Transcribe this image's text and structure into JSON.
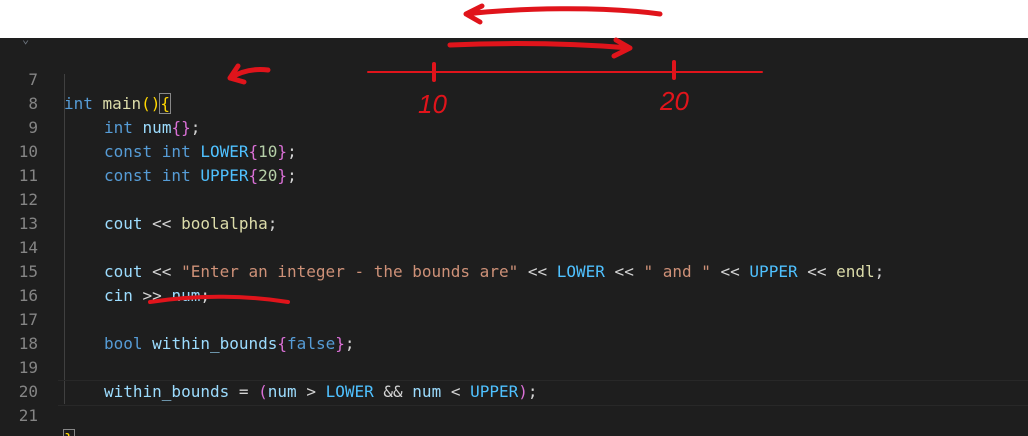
{
  "editor": {
    "lines": [
      {
        "n": "7"
      },
      {
        "n": "8"
      },
      {
        "n": "9"
      },
      {
        "n": "10"
      },
      {
        "n": "11"
      },
      {
        "n": "12"
      },
      {
        "n": "13"
      },
      {
        "n": "14"
      },
      {
        "n": "15"
      },
      {
        "n": "16"
      },
      {
        "n": "17"
      },
      {
        "n": "18"
      },
      {
        "n": "19"
      },
      {
        "n": "20"
      },
      {
        "n": "21"
      }
    ],
    "tokens": {
      "l7_kw": "int",
      "l7_fn": "main",
      "l7_paren": "()",
      "l7_brace": "{",
      "l8_kw": "int",
      "l8_var": "num",
      "l8_init": "{}",
      "l8_semi": ";",
      "l9_kw": "const int",
      "l9_var": "LOWER",
      "l9_open": "{",
      "l9_num": "10",
      "l9_close": "}",
      "l9_semi": ";",
      "l10_kw": "const int",
      "l10_var": "UPPER",
      "l10_open": "{",
      "l10_num": "20",
      "l10_close": "}",
      "l10_semi": ";",
      "l12_var": "cout",
      "l12_op": " << ",
      "l12_fn": "boolalpha",
      "l12_semi": ";",
      "l14_var": "cout",
      "l14_op1": " << ",
      "l14_str1": "\"Enter an integer - the bounds are\"",
      "l14_op2": " << ",
      "l14_var2": "LOWER",
      "l14_op3": " << ",
      "l14_str2": "\" and \"",
      "l14_op4": " << ",
      "l14_var3": "UPPER",
      "l14_op5": " << ",
      "l14_fn": "endl",
      "l14_semi": ";",
      "l15_var": "cin",
      "l15_op": " >> ",
      "l15_var2": "num",
      "l15_semi": ";",
      "l17_kw": "bool",
      "l17_var": "within_bounds",
      "l17_open": "{",
      "l17_val": "false",
      "l17_close": "}",
      "l17_semi": ";",
      "l19_var": "within_bounds",
      "l19_eq": " = ",
      "l19_open": "(",
      "l19_v1": "num",
      "l19_gt": " > ",
      "l19_v2": "LOWER",
      "l19_and": " && ",
      "l19_v3": "num",
      "l19_lt": " < ",
      "l19_v4": "UPPER",
      "l19_close": ")",
      "l19_semi": ";",
      "l21_brace": "}"
    }
  },
  "annotations": {
    "label_low": "10",
    "label_high": "20",
    "ink_color": "#e0141b"
  }
}
